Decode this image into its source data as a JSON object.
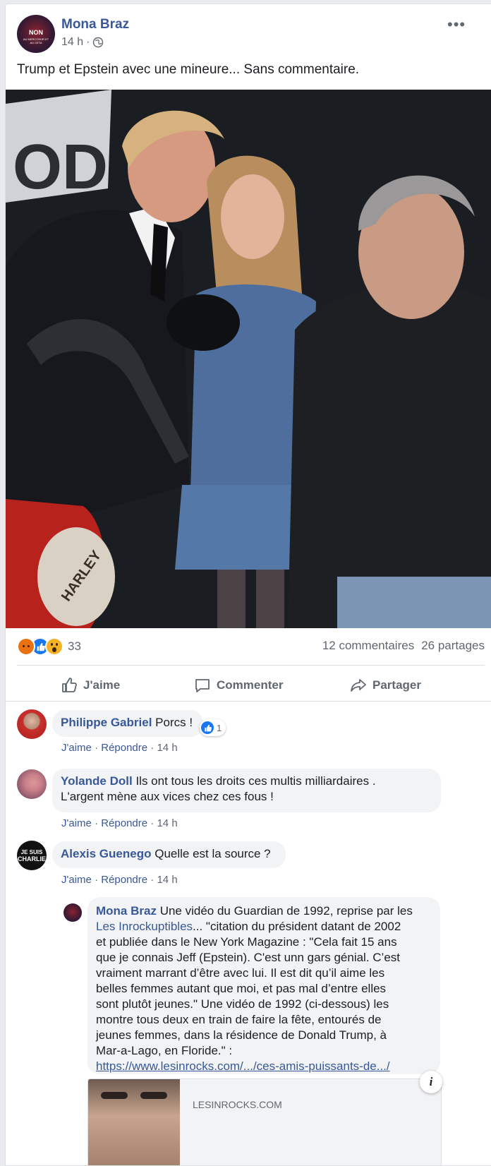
{
  "post": {
    "author": "Mona Braz",
    "time": "14 h",
    "dot": "·",
    "text": "Trump et Epstein avec une mineure... Sans commentaire.",
    "avatar_text_top": "NON",
    "avatar_text_bottom": "AU MERCOSUR ET AU CETA",
    "photo_text_sign": "OD",
    "photo_text_bike": "HARLEY"
  },
  "stats": {
    "reactions_count": "33",
    "comments": "12 commentaires",
    "shares": "26 partages"
  },
  "actions": {
    "like": "J'aime",
    "comment": "Commenter",
    "share": "Partager"
  },
  "comments": [
    {
      "author": "Philippe Gabriel",
      "text": "Porcs !",
      "reaction_count": "1",
      "like": "J'aime",
      "reply": "Répondre",
      "time": "14 h",
      "sep": "·"
    },
    {
      "author": "Yolande Doll",
      "text_line1": "Ils ont tous les droits ces multis milliardaires .",
      "text_line2": "L'argent mène aux vices chez ces fous !",
      "like": "J'aime",
      "reply": "Répondre",
      "time": "14 h",
      "sep": "·"
    },
    {
      "author": "Alexis Guenego",
      "text": "Quelle est la source ?",
      "avatar_text_top": "JE SUIS",
      "avatar_text_bottom": "CHARLIE",
      "like": "J'aime",
      "reply": "Répondre",
      "time": "14 h",
      "sep": "·"
    }
  ],
  "reply": {
    "author": "Mona Braz",
    "text_1": "Une vidéo du Guardian de 1992, reprise par les",
    "mention": "Les Inrockuptibles",
    "text_2": "... \"citation du président datant de 2002",
    "lines": [
      "et publiée dans le New York Magazine : \"Cela fait 15 ans",
      "que je connais Jeff (Epstein). C'est unn gars génial. C’est",
      "vraiment marrant d’être avec lui. Il est dit qu’il aime les",
      "belles femmes autant que moi, et pas mal d’entre elles",
      "sont plutôt jeunes.\" Une vidéo de 1992 (ci-dessous) les",
      "montre tous deux en train de faire la fête, entourés de",
      "jeunes femmes, dans la résidence de Donald Trump, à",
      "Mar-a-Lago, en Floride.\" :"
    ],
    "url": "https://www.lesinrocks.com/.../ces-amis-puissants-de.../",
    "preview_domain": "LESINROCKS.COM",
    "info_icon": "i"
  },
  "colors": {
    "link": "#385898",
    "meta": "#606770",
    "bubble": "#f2f3f5",
    "like_blue": "#1877f2",
    "angry": "#e9710f",
    "wow": "#f7b125"
  }
}
